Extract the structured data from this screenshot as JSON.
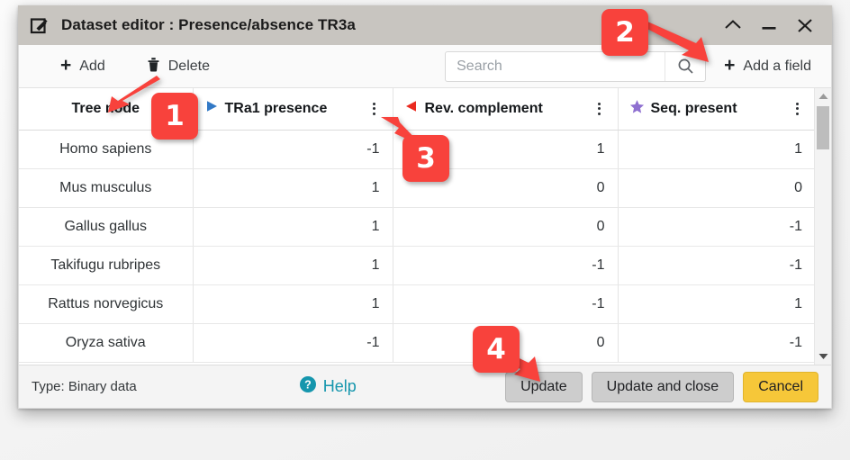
{
  "window": {
    "title": "Dataset editor : Presence/absence TR3a",
    "icon": "edit-pencil-icon",
    "controls": [
      {
        "name": "collapse",
        "glyph": "chevron-up-icon"
      },
      {
        "name": "minimize",
        "glyph": "minimize-icon"
      },
      {
        "name": "close",
        "glyph": "close-icon"
      }
    ]
  },
  "toolbar": {
    "add_label": "Add",
    "delete_label": "Delete",
    "add_field_label": "Add a field",
    "search_placeholder": "Search",
    "search_value": ""
  },
  "table": {
    "columns": [
      {
        "label": "Tree node",
        "icon": "none",
        "icon_color": ""
      },
      {
        "label": "TRa1 presence",
        "icon": "triangle-right-icon",
        "icon_color": "#3279c6"
      },
      {
        "label": "Rev. complement",
        "icon": "triangle-left-icon",
        "icon_color": "#ea2a20"
      },
      {
        "label": "Seq. present",
        "icon": "star-icon",
        "icon_color": "#8e6fd0"
      }
    ],
    "rows": [
      {
        "node": "Homo sapiens",
        "tra1": "-1",
        "rev": "1",
        "seq": "1"
      },
      {
        "node": "Mus musculus",
        "tra1": "1",
        "rev": "0",
        "seq": "0"
      },
      {
        "node": "Gallus gallus",
        "tra1": "1",
        "rev": "0",
        "seq": "-1"
      },
      {
        "node": "Takifugu rubripes",
        "tra1": "1",
        "rev": "-1",
        "seq": "-1"
      },
      {
        "node": "Rattus norvegicus",
        "tra1": "1",
        "rev": "-1",
        "seq": "1"
      },
      {
        "node": "Oryza sativa",
        "tra1": "-1",
        "rev": "0",
        "seq": "-1"
      }
    ]
  },
  "footer": {
    "type_text": "Type: Binary data",
    "help_label": "Help",
    "update_label": "Update",
    "update_close_label": "Update and close",
    "cancel_label": "Cancel"
  },
  "annotations": [
    {
      "number": "1"
    },
    {
      "number": "2"
    },
    {
      "number": "3"
    },
    {
      "number": "4"
    }
  ],
  "colors": {
    "badge": "#f8423c",
    "titlebar": "#c8c5c0",
    "help": "#1596ad",
    "cancel": "#f6c739"
  }
}
